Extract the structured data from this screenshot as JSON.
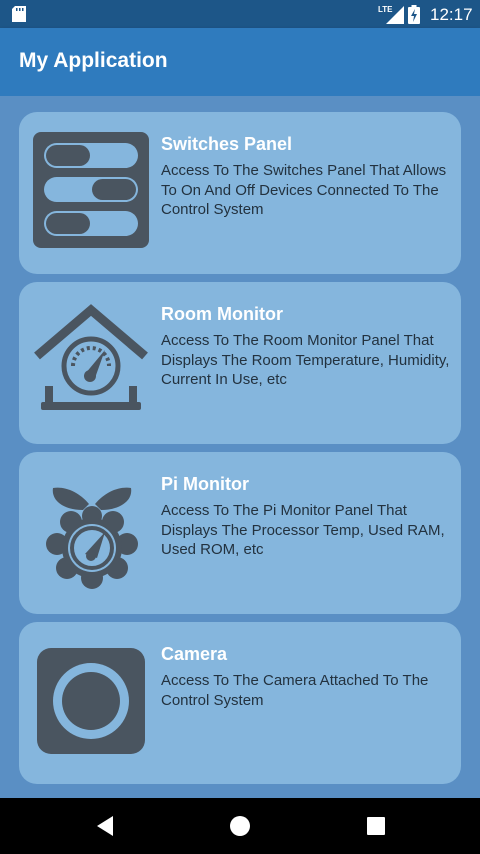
{
  "status_bar": {
    "network_label": "LTE",
    "time": "12:17",
    "icons": [
      "sd-card-icon",
      "lte-signal-icon",
      "battery-charging-icon"
    ]
  },
  "app_bar": {
    "title": "My Application"
  },
  "cards": [
    {
      "title": "Switches Panel",
      "description": "Access To The Switches Panel That Allows To On And Off Devices Connected To The Control System",
      "icon": "switches-icon"
    },
    {
      "title": "Room Monitor",
      "description": "Access To The Room Monitor Panel That Displays The Room Temperature, Humidity, Current In Use, etc",
      "icon": "room-monitor-icon"
    },
    {
      "title": "Pi Monitor",
      "description": "Access To The Pi Monitor Panel That Displays The Processor Temp, Used RAM, Used ROM, etc",
      "icon": "pi-monitor-icon"
    },
    {
      "title": "Camera",
      "description": "Access To The Camera Attached To The Control System",
      "icon": "camera-icon"
    }
  ],
  "nav_bar": {
    "buttons": [
      "back-icon",
      "home-icon",
      "recents-icon"
    ]
  },
  "colors": {
    "status_bar": "#1d5688",
    "app_bar": "#2f7bbe",
    "background": "#5a8fc4",
    "card": "#85b6dd",
    "icon": "#4a5560",
    "text": "#23323f"
  }
}
